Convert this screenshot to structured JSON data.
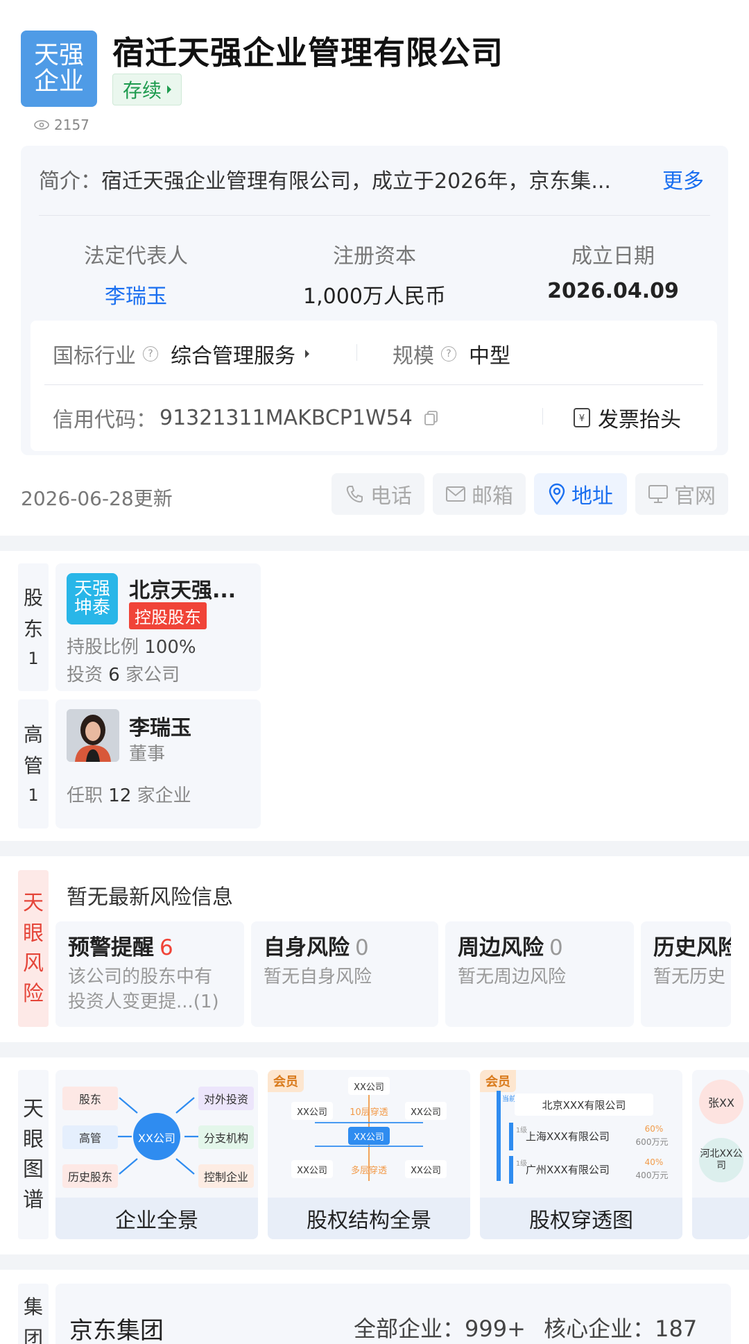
{
  "company": {
    "logo_line1": "天强",
    "logo_line2": "企业",
    "name": "宿迁天强企业管理有限公司",
    "status": "存续",
    "views": "2157",
    "intro_label": "简介：",
    "intro_text": "宿迁天强企业管理有限公司，成立于2026年，京东集...",
    "more_label": "更多"
  },
  "key_info": {
    "legal_rep_label": "法定代表人",
    "legal_rep_value": "李瑞玉",
    "capital_label": "注册资本",
    "capital_value": "1,000万人民币",
    "founded_label": "成立日期",
    "founded_value": "2026.04.09",
    "industry_label": "国标行业",
    "industry_value": "综合管理服务",
    "scale_label": "规模",
    "scale_value": "中型",
    "credit_label": "信用代码：",
    "credit_value": "91321311MAKBCP1W54",
    "invoice_label": "发票抬头"
  },
  "update_text": "2026-06-28更新",
  "actions": [
    {
      "label": "电话",
      "icon": "phone-icon"
    },
    {
      "label": "邮箱",
      "icon": "mail-icon"
    },
    {
      "label": "地址",
      "icon": "location-icon"
    },
    {
      "label": "官网",
      "icon": "monitor-icon"
    }
  ],
  "shareholder": {
    "tab": [
      "股",
      "东",
      "1"
    ],
    "logo_line1": "天强",
    "logo_line2": "坤泰",
    "name": "北京天强...",
    "tag": "控股股东",
    "ratio_label": "持股比例",
    "ratio_value": "100%",
    "invest_prefix": "投资",
    "invest_count": "6",
    "invest_suffix": "家公司"
  },
  "executive": {
    "tab": [
      "高",
      "管",
      "1"
    ],
    "name": "李瑞玉",
    "title": "董事",
    "post_prefix": "任职",
    "post_count": "12",
    "post_suffix": "家企业"
  },
  "risk": {
    "tab": [
      "天",
      "眼",
      "风",
      "险"
    ],
    "summary": "暂无最新风险信息",
    "cards": [
      {
        "title": "预警提醒",
        "count": "6",
        "desc1": "该公司的股东中有",
        "desc2": "投资人变更提...(1)"
      },
      {
        "title": "自身风险",
        "count": "0",
        "desc1": "暂无自身风险",
        "desc2": ""
      },
      {
        "title": "周边风险",
        "count": "0",
        "desc1": "暂无周边风险",
        "desc2": ""
      },
      {
        "title": "历史风险",
        "count": "",
        "desc1": "暂无历史",
        "desc2": ""
      }
    ]
  },
  "graph": {
    "tab": [
      "天",
      "眼",
      "图",
      "谱"
    ],
    "vip_label": "会员",
    "cards": [
      {
        "label": "企业全景",
        "nodes": {
          "n1": "股东",
          "n2": "高管",
          "n3": "历史股东",
          "center": "XX公司",
          "n4": "对外投资",
          "n5": "分支机构",
          "n6": "控制企业"
        }
      },
      {
        "label": "股权结构全景",
        "nodes": {
          "top": "XX公司",
          "l1": "XX公司",
          "mid_top": "10层穿透",
          "r1": "XX公司",
          "center": "XX公司",
          "l2": "XX公司",
          "mid_bot": "多层穿透",
          "r2": "XX公司"
        }
      },
      {
        "label": "股权穿透图",
        "nodes": {
          "root_tag": "当前",
          "root": "北京XXX有限公司",
          "c1_tag": "1级",
          "c1": "上海XXX有限公司",
          "c1_pct": "60%",
          "c1_amt": "600万元",
          "c2_tag": "1级",
          "c2": "广州XXX有限公司",
          "c2_pct": "40%",
          "c2_amt": "400万元"
        }
      },
      {
        "label": "",
        "nodes": {
          "a": "张XX",
          "b": "河北XX公司"
        }
      }
    ]
  },
  "group": {
    "tab": [
      "集",
      "团"
    ],
    "name": "京东集团",
    "all_label": "全部企业：",
    "all_value": "999+",
    "core_label": "核心企业：",
    "core_value": "187"
  },
  "colors": {
    "accent_blue": "#1a6ff0",
    "status_green": "#1e9b4f",
    "risk_red": "#e5463a",
    "logo_blue": "#4f9be6"
  }
}
